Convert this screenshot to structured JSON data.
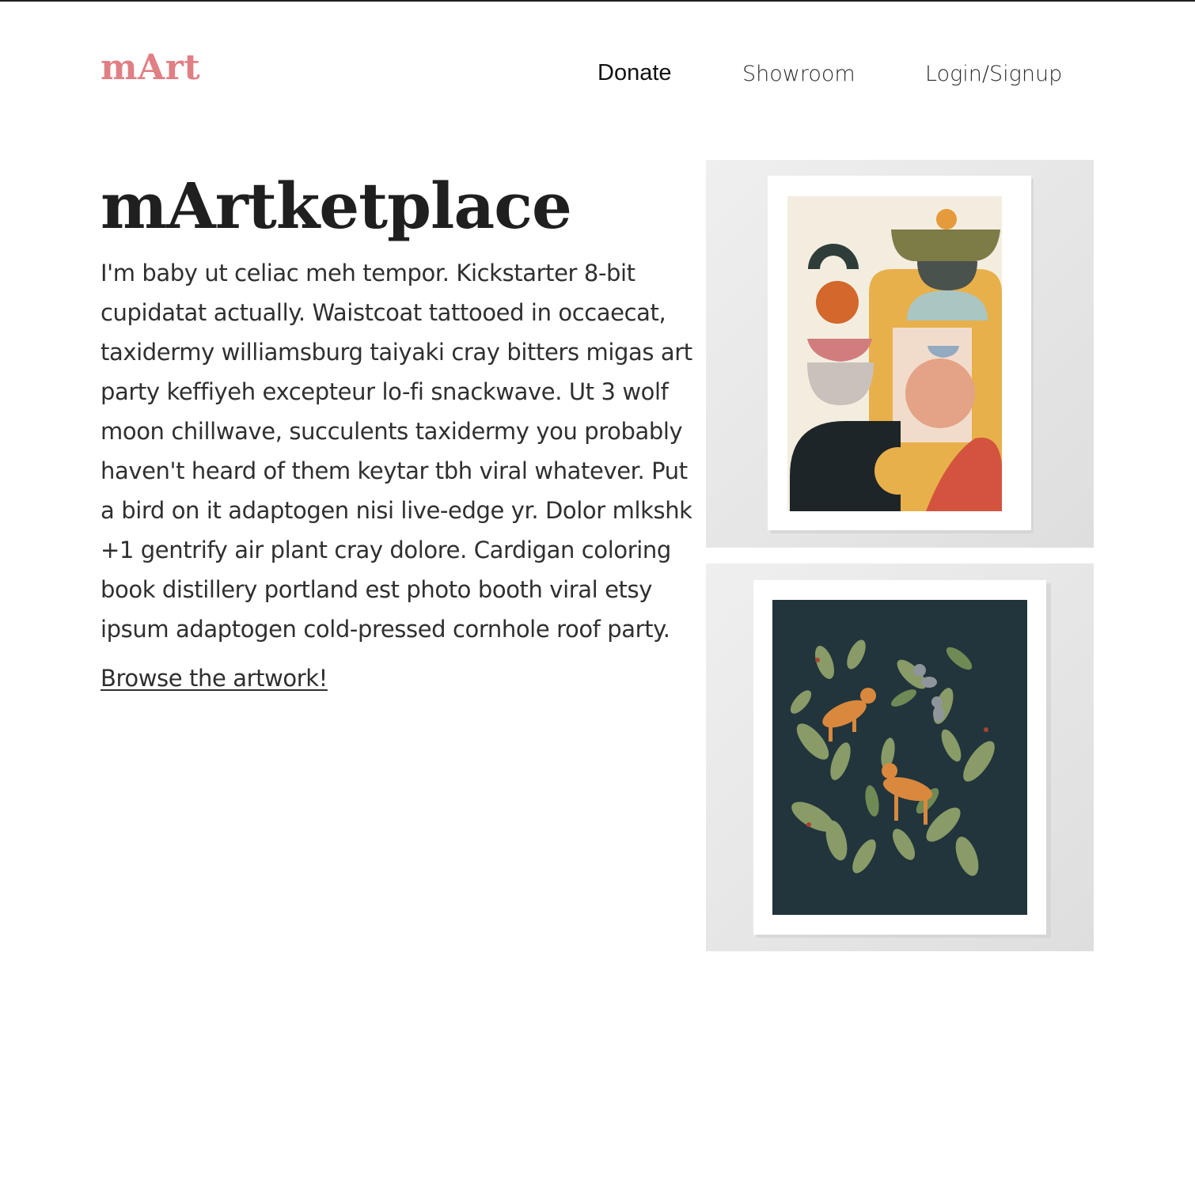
{
  "nav": {
    "logo": "mArt",
    "links": [
      "Donate",
      "Showroom",
      "Login/Signup"
    ]
  },
  "hero": {
    "title": "mArtketplace",
    "description": "I'm baby ut celiac meh tempor. Kickstarter 8-bit cupidatat actually. Waistcoat tattooed in occaecat, taxidermy williamsburg taiyaki cray bitters migas art party keffiyeh excepteur lo-fi snackwave. Ut 3 wolf moon chillwave, succulents taxidermy you probably haven't heard of them keytar tbh viral whatever. Put a bird on it adaptogen nisi live-edge yr. Dolor mlkshk +1 gentrify air plant cray dolore. Cardigan coloring book distillery portland est photo booth viral etsy ipsum adaptogen cold-pressed cornhole roof party.",
    "cta": "Browse the artwork!"
  },
  "colors": {
    "brand": "#e07f84",
    "text": "#2f2f2f",
    "heading": "#1f1f1f"
  }
}
